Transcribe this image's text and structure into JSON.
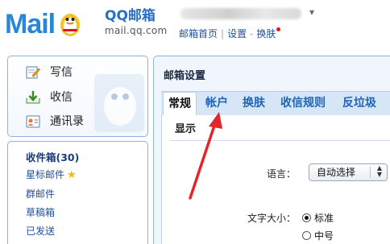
{
  "header": {
    "logo_text": "Mail",
    "brand_name": "QQ邮箱",
    "brand_url": "mail.qq.com",
    "links": [
      "邮箱首页",
      "设置",
      "换肤"
    ]
  },
  "left": {
    "actions": [
      {
        "label": "写信",
        "icon": "compose-icon"
      },
      {
        "label": "收信",
        "icon": "inbox-download-icon"
      },
      {
        "label": "通讯录",
        "icon": "contacts-icon"
      }
    ],
    "folders": {
      "inbox": "收件箱(30)",
      "starred": "星标邮件",
      "groups": "群邮件",
      "drafts": "草稿箱",
      "sent": "已发送"
    }
  },
  "main": {
    "title": "邮箱设置",
    "tabs": [
      "常规",
      "帐户",
      "换肤",
      "收信规则",
      "反垃圾"
    ],
    "active_tab": "常规",
    "section": "显示",
    "language_label": "语言：",
    "language_value": "自动选择",
    "fontsize_label": "文字大小：",
    "fontsize_options": [
      "标准",
      "中号"
    ],
    "fontsize_selected": "标准"
  },
  "colors": {
    "accent": "#2a86d8",
    "tab_link": "#1e63b8",
    "panel_border": "#8fb3df",
    "arrow": "#e3262b"
  }
}
